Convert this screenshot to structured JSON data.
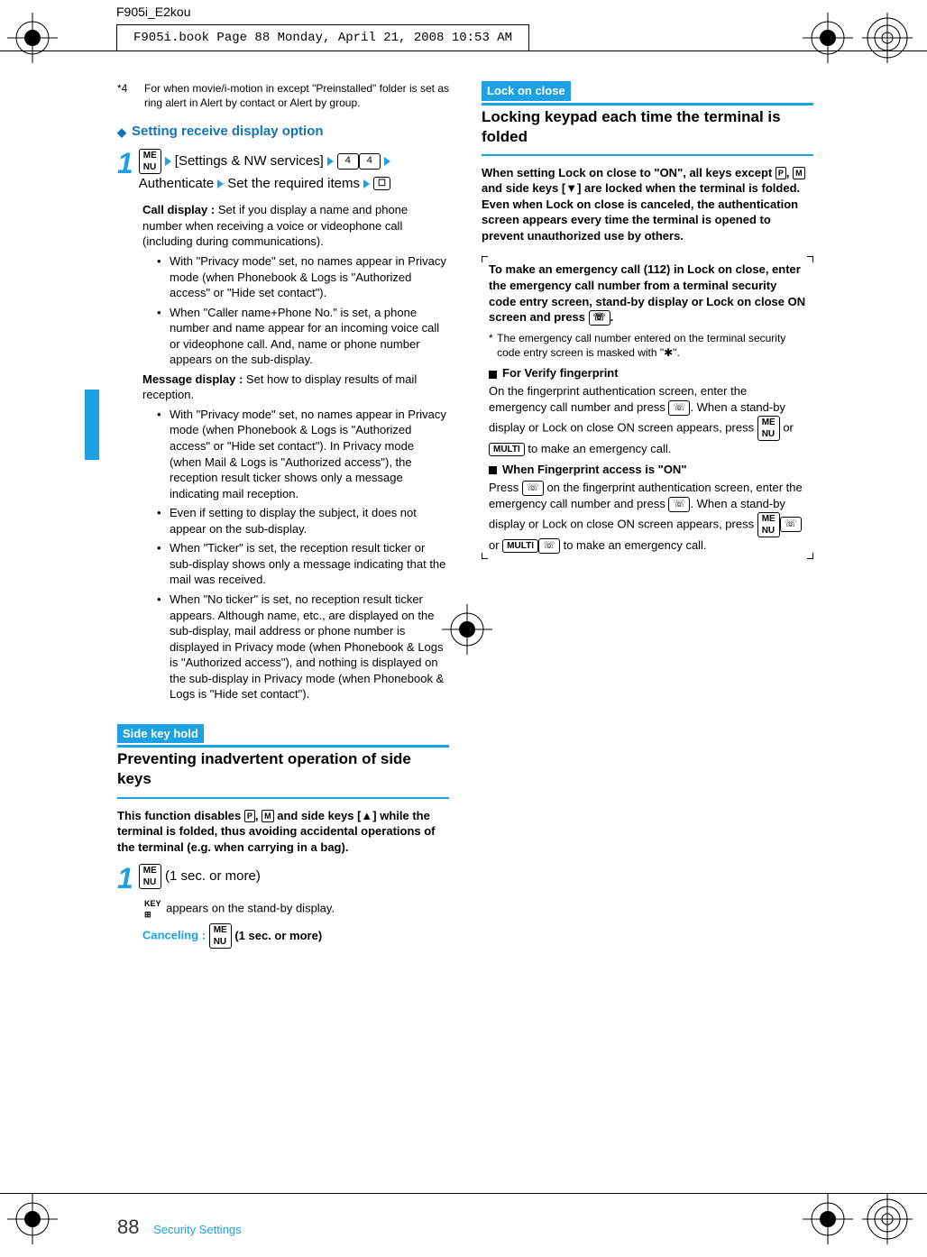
{
  "header": {
    "filename": "F905i_E2kou",
    "book_info": "F905i.book  Page 88  Monday, April 21, 2008  10:53 AM"
  },
  "left": {
    "footnote": {
      "label": "*4",
      "text": "For when movie/i-motion in except \"Preinstalled\" folder is set as ring alert in Alert by contact or Alert by group."
    },
    "option_head": "Setting receive display option",
    "step1_prefix": "[Settings & NW services]",
    "step1_auth": "Authenticate",
    "step1_set": "Set the required items",
    "call_label": "Call display :",
    "call_text": "Set if you display a name and phone number when receiving a voice or videophone call (including during communications).",
    "call_b1": "With \"Privacy mode\" set, no names appear in Privacy mode (when Phonebook & Logs is \"Authorized access\" or \"Hide set contact\").",
    "call_b2": "When \"Caller name+Phone No.\" is set, a phone number and name appear for an incoming voice call or videophone call. And, name or phone number appears on the sub-display.",
    "msg_label": "Message display :",
    "msg_text": "Set how to display results of mail reception.",
    "msg_b1": "With \"Privacy mode\" set, no names appear in Privacy mode (when Phonebook & Logs is \"Authorized access\" or \"Hide set contact\"). In Privacy mode (when Mail & Logs is \"Authorized access\"), the reception result ticker shows only a message indicating mail reception.",
    "msg_b2": "Even if setting to display the subject, it does not appear on the sub-display.",
    "msg_b3": "When \"Ticker\" is set, the reception result ticker or sub-display shows only a message indicating that the mail was received.",
    "msg_b4": "When \"No ticker\" is set, no reception result ticker appears. Although name, etc., are displayed on the sub-display, mail address or phone number is displayed in Privacy mode (when Phonebook & Logs is \"Authorized access\"), and nothing is displayed on the sub-display in Privacy mode (when Phonebook & Logs is \"Hide set contact\").",
    "sidekey_chip": "Side key hold",
    "sidekey_head": "Preventing inadvertent operation of side keys",
    "sidekey_intro_a": "This function disables ",
    "sidekey_intro_b": " and side keys [▲] while the terminal is folded, thus avoiding accidental operations of the terminal (e.g. when carrying in a bag).",
    "sidekey_step": "(1 sec. or more)",
    "sidekey_note": " appears on the stand-by display.",
    "cancel_label": "Canceling :",
    "cancel_text": "(1 sec. or more)"
  },
  "right": {
    "lock_chip": "Lock on close",
    "lock_head": "Locking keypad each time the terminal is folded",
    "lock_intro_a": "When setting Lock on close to \"ON\", all keys except ",
    "lock_intro_b": " and side keys [▼] are locked when the terminal is folded. Even when Lock on close is canceled, the authentication screen appears every time the terminal is opened to prevent unauthorized use by others.",
    "box_bold": "To make an emergency call (112) in Lock on close, enter the emergency call number from a terminal security code entry screen, stand-by display or Lock on close ON screen and press ",
    "box_note": "The emergency call number entered on the terminal security code entry screen is masked with \"✱\".",
    "fp_head": "For Verify fingerprint",
    "fp_text_a": "On the fingerprint authentication screen, enter the emergency call number and press ",
    "fp_text_b": ". When a stand-by display or Lock on close ON screen appears, press ",
    "fp_text_c": " to make an emergency call.",
    "fp2_head": "When Fingerprint access is \"ON\"",
    "fp2_text_a": "Press ",
    "fp2_text_b": " on the fingerprint authentication screen, enter the emergency call number and press ",
    "fp2_text_c": ". When a stand-by display or Lock on close ON screen appears, press ",
    "fp2_text_d": " to make an emergency call."
  },
  "footer": {
    "page": "88",
    "section": "Security Settings"
  }
}
